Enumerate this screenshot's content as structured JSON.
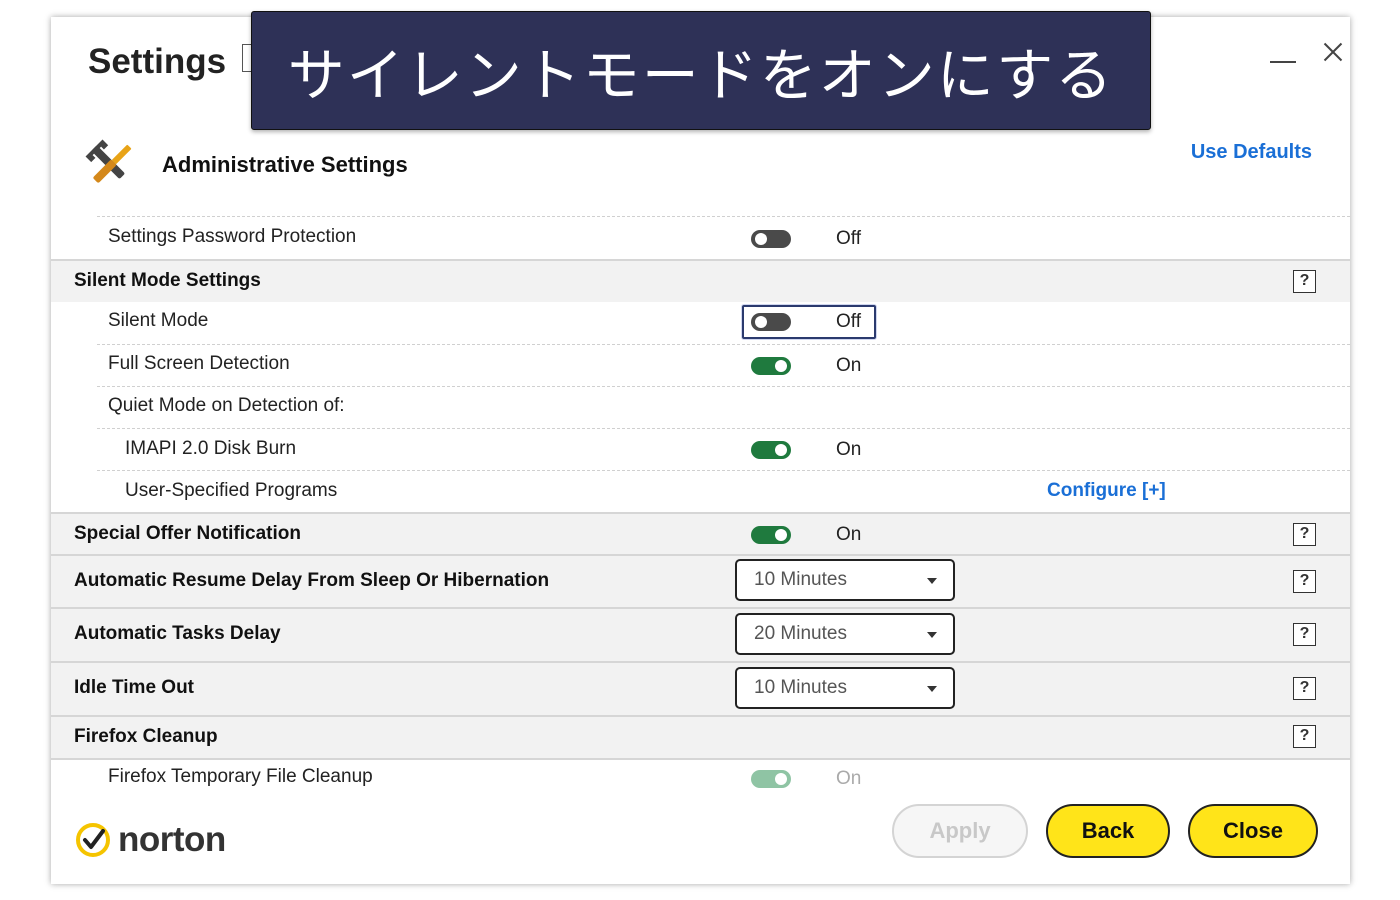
{
  "window": {
    "title": "Settings"
  },
  "overlay": {
    "caption": "サイレントモードをオンにする"
  },
  "header": {
    "section_title": "Administrative Settings",
    "use_defaults": "Use Defaults"
  },
  "rows": {
    "password_protection": {
      "label": "Settings Password Protection",
      "state": "Off"
    },
    "silent_mode_settings": {
      "label": "Silent Mode Settings",
      "help": "?"
    },
    "silent_mode": {
      "label": "Silent Mode",
      "state": "Off"
    },
    "full_screen_detection": {
      "label": "Full Screen Detection",
      "state": "On"
    },
    "quiet_mode": {
      "label": "Quiet Mode on Detection of:"
    },
    "imapi_disk_burn": {
      "label": "IMAPI 2.0 Disk Burn",
      "state": "On"
    },
    "user_programs": {
      "label": "User-Specified Programs",
      "configure": "Configure [+]"
    },
    "special_offer": {
      "label": "Special Offer Notification",
      "state": "On",
      "help": "?"
    },
    "resume_delay": {
      "label": "Automatic Resume Delay From Sleep Or Hibernation",
      "value": "10 Minutes",
      "help": "?"
    },
    "tasks_delay": {
      "label": "Automatic Tasks Delay",
      "value": "20 Minutes",
      "help": "?"
    },
    "idle_timeout": {
      "label": "Idle Time Out",
      "value": "10 Minutes",
      "help": "?"
    },
    "firefox_cleanup": {
      "label": "Firefox Cleanup",
      "help": "?"
    },
    "firefox_temp": {
      "label": "Firefox Temporary File Cleanup",
      "state": "On"
    }
  },
  "footer": {
    "brand": "norton",
    "apply": "Apply",
    "back": "Back",
    "close": "Close"
  },
  "colors": {
    "accent_yellow": "#ffe419",
    "toggle_on": "#1f7a3e",
    "toggle_off": "#4a4a4a",
    "link_blue": "#1a6fd6",
    "overlay_bg": "#2e3157"
  },
  "icons": [
    "minimize-icon",
    "close-icon",
    "admin-tools-icon",
    "help-icon",
    "dropdown-arrow-icon",
    "norton-check-icon"
  ]
}
